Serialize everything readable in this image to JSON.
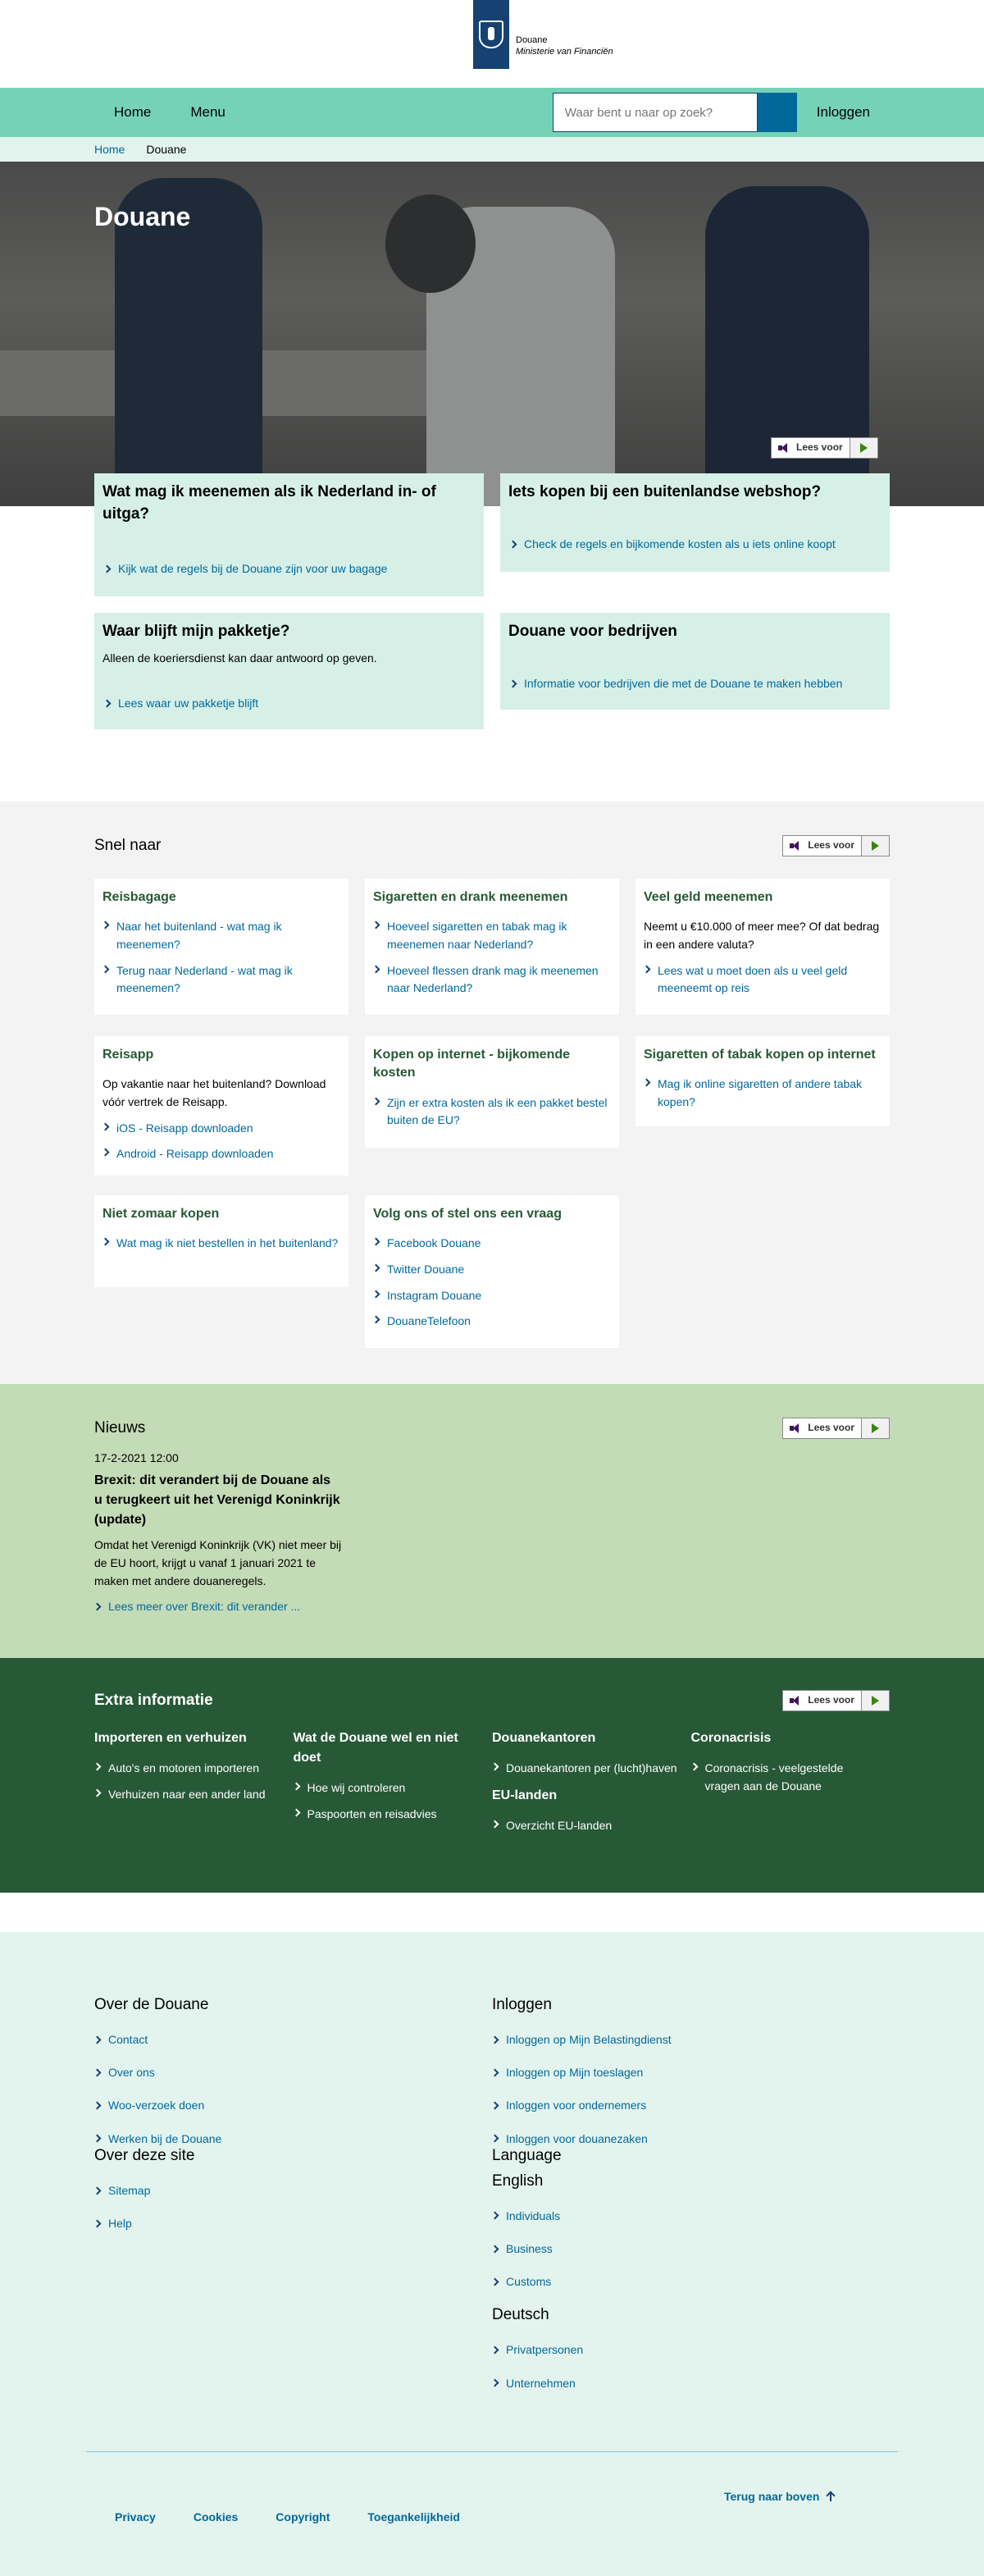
{
  "header": {
    "logo_line1": "Douane",
    "logo_line2": "Ministerie van Financiën"
  },
  "nav": {
    "home": "Home",
    "menu": "Menu",
    "search_placeholder": "Waar bent u naar op zoek?",
    "login": "Inloggen"
  },
  "breadcrumb": {
    "home": "Home",
    "current": "Douane"
  },
  "hero": {
    "title": "Douane",
    "readaloud": "Lees voor"
  },
  "cards": [
    {
      "title": "Wat mag ik meenemen als ik Nederland in- of uitga?",
      "text": "",
      "link": "Kijk wat de regels bij de Douane zijn voor uw bagage"
    },
    {
      "title": "Iets kopen bij een buitenlandse webshop?",
      "text": "",
      "link": "Check de regels en bijkomende kosten als u iets online koopt"
    },
    {
      "title": "Waar blijft mijn pakketje?",
      "text": "Alleen de koeriersdienst kan daar antwoord op geven.",
      "link": "Lees waar uw pakketje blijft"
    },
    {
      "title": "Douane voor bedrijven",
      "text": "",
      "link": "Informatie voor bedrijven die met de Douane te maken hebben"
    }
  ],
  "snel": {
    "title": "Snel naar",
    "readaloud": "Lees voor",
    "tiles": [
      {
        "title": "Reisbagage",
        "text": "",
        "links": [
          "Naar het buitenland - wat mag ik meenemen?",
          "Terug naar Nederland - wat mag ik meenemen?"
        ]
      },
      {
        "title": "Sigaretten en drank meenemen",
        "text": "",
        "links": [
          "Hoeveel sigaretten en tabak mag ik meenemen naar Nederland?",
          "Hoeveel flessen drank mag ik meenemen naar Nederland?"
        ]
      },
      {
        "title": "Veel geld meenemen",
        "text": "Neemt u €10.000 of meer mee? Of dat bedrag in een andere valuta?",
        "links": [
          "Lees wat u moet doen als u veel geld meeneemt op reis"
        ]
      },
      {
        "title": "Reisapp",
        "text": "Op vakantie naar het buitenland? Download vóór vertrek de Reisapp.",
        "links": [
          "iOS - Reisapp downloaden",
          "Android - Reisapp downloaden"
        ]
      },
      {
        "title": "Kopen op internet - bijkomende kosten",
        "text": "",
        "links": [
          "Zijn er extra kosten als ik een pakket bestel buiten de EU?"
        ]
      },
      {
        "title": "Sigaretten of tabak kopen op internet",
        "text": "",
        "links": [
          "Mag ik online sigaretten of andere tabak kopen?"
        ]
      },
      {
        "title": "Niet zomaar kopen",
        "text": "",
        "links": [
          "Wat mag ik niet bestellen in het buitenland?"
        ]
      },
      {
        "title": "Volg ons of stel ons een vraag",
        "text": "",
        "links": [
          "Facebook Douane",
          "Twitter Douane",
          "Instagram Douane",
          "DouaneTelefoon"
        ]
      }
    ]
  },
  "nieuws": {
    "title": "Nieuws",
    "readaloud": "Lees voor",
    "date": "17-2-2021 12:00",
    "headline": "Brexit: dit verandert bij de Douane als u terugkeert uit het Verenigd Koninkrijk (update)",
    "text": "Omdat het Verenigd Koninkrijk (VK) niet meer bij de EU hoort, krijgt u vanaf 1 januari 2021 te maken met andere douaneregels.",
    "more": "Lees meer over Brexit: dit verander ..."
  },
  "extra": {
    "title": "Extra informatie",
    "readaloud": "Lees voor",
    "columns": [
      {
        "title": "Importeren en verhuizen",
        "links": [
          "Auto's en motoren importeren",
          "Verhuizen naar een ander land"
        ]
      },
      {
        "title": "Wat de Douane wel en niet doet",
        "links": [
          "Hoe wij controleren",
          "Paspoorten en reisadvies"
        ]
      },
      {
        "title": "Douanekantoren",
        "links": [
          "Douanekantoren per (lucht)haven"
        ],
        "title2": "EU-landen",
        "links2": [
          "Overzicht EU-landen"
        ]
      },
      {
        "title": "Coronacrisis",
        "links": [
          "Coronacrisis - veelgestelde vragen aan de Douane"
        ]
      }
    ]
  },
  "footer": {
    "over_title": "Over de Douane",
    "over_links": [
      "Contact",
      "Over ons",
      "Woo-verzoek doen",
      "Werken bij de Douane"
    ],
    "site_title": "Over deze site",
    "site_links": [
      "Sitemap",
      "Help"
    ],
    "login_title": "Inloggen",
    "login_links": [
      "Inloggen op Mijn Belastingdienst",
      "Inloggen op Mijn toeslagen",
      "Inloggen voor ondernemers",
      "Inloggen voor douanezaken"
    ],
    "language_title": "Language",
    "english_title": "English",
    "english_links": [
      "Individuals",
      "Business",
      "Customs"
    ],
    "deutsch_title": "Deutsch",
    "deutsch_links": [
      "Privatpersonen",
      "Unternehmen"
    ],
    "bottom_links": [
      "Privacy",
      "Cookies",
      "Copyright",
      "Toegankelijkheid"
    ],
    "to_top": "Terug naar boven"
  }
}
